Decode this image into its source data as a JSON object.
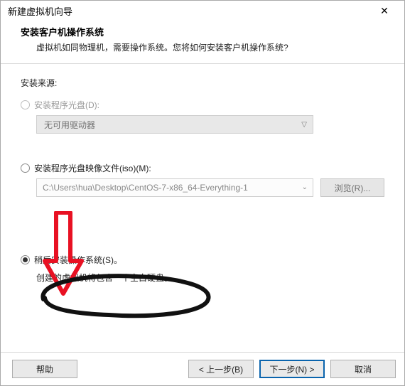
{
  "window": {
    "title": "新建虚拟机向导",
    "close_label": "✕"
  },
  "header": {
    "title": "安装客户机操作系统",
    "subtitle": "虚拟机如同物理机，需要操作系统。您将如何安装客户机操作系统?"
  },
  "source_section_label": "安装来源:",
  "option_disc": {
    "label": "安装程序光盘(D):",
    "combo_text": "无可用驱动器"
  },
  "option_iso": {
    "label": "安装程序光盘映像文件(iso)(M):",
    "path_value": "C:\\Users\\hua\\Desktop\\CentOS-7-x86_64-Everything-1",
    "browse_label": "浏览(R)..."
  },
  "option_later": {
    "label": "稍后安装操作系统(S)。",
    "hint": "创建的虚拟机将包含一个空白硬盘。"
  },
  "footer": {
    "help": "帮助",
    "back": "< 上一步(B)",
    "next": "下一步(N) >",
    "cancel": "取消"
  }
}
